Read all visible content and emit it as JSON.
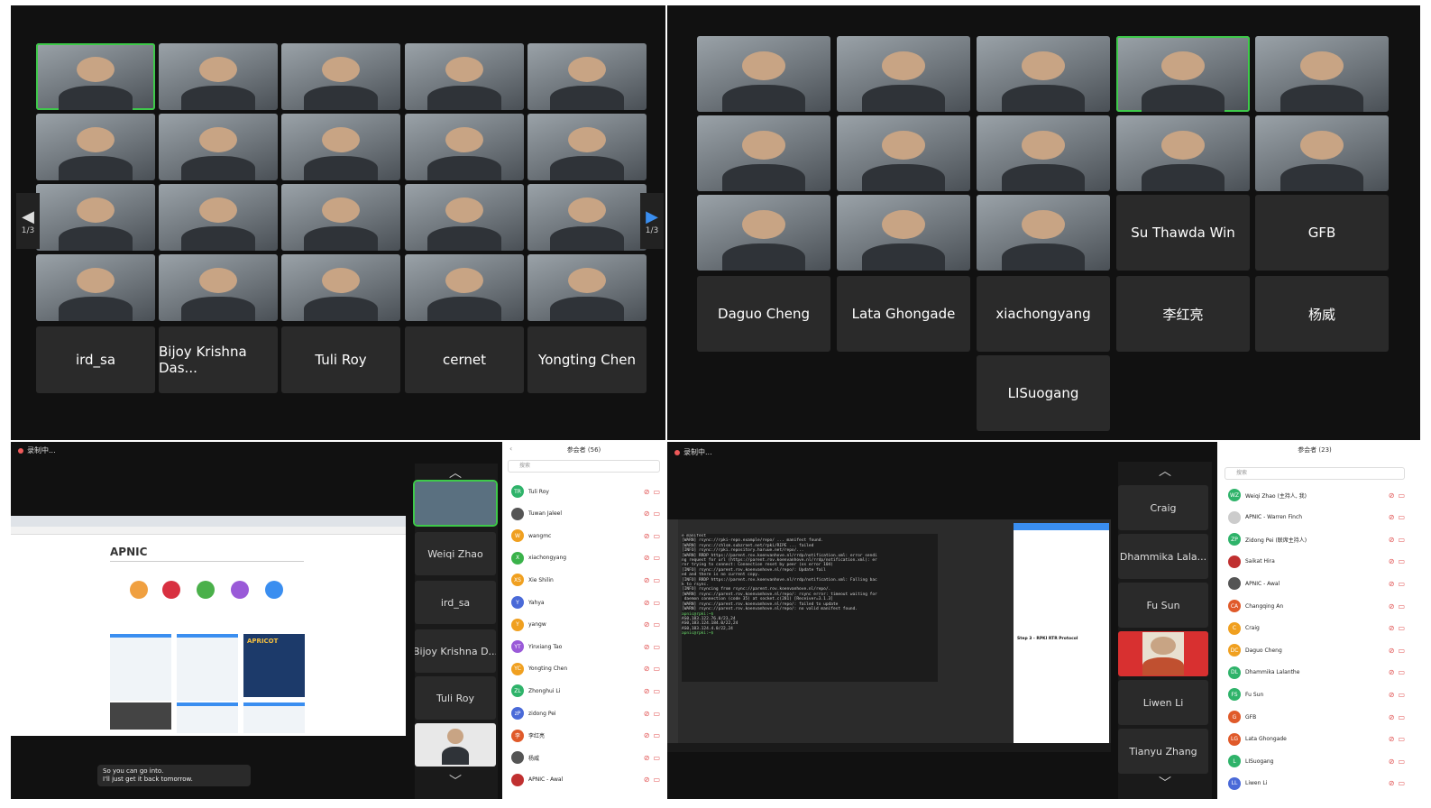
{
  "colors": {
    "active_border": "#3ec94a",
    "rec_dot": "#f05a5a",
    "nav_blue": "#3a8ef0",
    "tile_bg": "#2a2a2a"
  },
  "q1": {
    "tiles_row1": [
      "",
      "",
      "",
      "",
      ""
    ],
    "name_tiles": [
      "ird_sa",
      "Bijoy Krishna Das...",
      "Tuli Roy",
      "cernet",
      "Yongting Chen"
    ],
    "page_left": "1/3",
    "page_right": "1/3",
    "left_arrow_icon": "chevron-left-icon",
    "right_arrow_icon": "chevron-right-icon"
  },
  "q2": {
    "name_tiles_row3": [
      "Su Thawda Win",
      "GFB"
    ],
    "name_tiles_row4": [
      "Daguo Cheng",
      "Lata Ghongade",
      "xiachongyang",
      "李红亮",
      "杨威"
    ],
    "name_tile_row5": "LISuogang"
  },
  "q3": {
    "rec_label": "录制中...",
    "page_brand": "APNIC",
    "strip_names": [
      "Weiqi Zhao",
      "ird_sa",
      "Bijoy Krishna D...",
      "Tuli Roy"
    ],
    "caption": "So you can go into.\nI'll just get it back tomorrow.",
    "apricot_label": "APRICOT"
  },
  "plist1": {
    "title": "参会者 (56)",
    "search": "搜索",
    "rows": [
      {
        "initials": "TR",
        "name": "Tuli Roy",
        "color": "#2fb36a"
      },
      {
        "initials": "",
        "name": "Tuwan Jaleel",
        "color": "#555555"
      },
      {
        "initials": "W",
        "name": "wangmc",
        "color": "#f0a020"
      },
      {
        "initials": "X",
        "name": "xiachongyang",
        "color": "#3ab24a"
      },
      {
        "initials": "XS",
        "name": "Xie Shilin",
        "color": "#f0a020"
      },
      {
        "initials": "Y",
        "name": "Yahya",
        "color": "#4a6ad8"
      },
      {
        "initials": "Y",
        "name": "yangw",
        "color": "#f0a020"
      },
      {
        "initials": "YT",
        "name": "Yinxiang Tao",
        "color": "#9a5ad8"
      },
      {
        "initials": "YC",
        "name": "Yongting Chen",
        "color": "#f0a020"
      },
      {
        "initials": "ZL",
        "name": "Zhonghui Li",
        "color": "#2fb36a"
      },
      {
        "initials": "zP",
        "name": "zidong Pei",
        "color": "#4a6ad8"
      },
      {
        "initials": "李",
        "name": "李红亮",
        "color": "#e05a2a"
      },
      {
        "initials": "",
        "name": "杨威",
        "color": "#555555"
      },
      {
        "initials": "",
        "name": "APNIC - Awal",
        "color": "#c03030"
      }
    ]
  },
  "q4": {
    "rec_label": "录制中...",
    "strip_names": [
      "Craig",
      "Dhammika Lala...",
      "Fu Sun",
      "",
      "Liwen Li",
      "Tianyu Zhang"
    ],
    "panel_heading": "Step 3 - RPKI RTR Protocol",
    "terminal_lines": [
      "e manifest",
      "[WARN] rsync://rpki-repo.example/repo/ ... manifest found.",
      "[WARN] rsync://chlsm.subzrnet.net/rpki/RIPE ... failed",
      "[INFO] rsync://rpki.repository.haruue.net/repo/...",
      "[WARN] RRDP https://parent.rov.koenvanhove.nl/rrdp/notification.xml: error sendi",
      "ng request for url (https://parent.rov.koenvanhove.nl/rrdp/notification.xml): er",
      "ror trying to connect: Connection reset by peer (os error 104)",
      "[INFO] rsync://parent.rov.koenvanhove.nl/repo/: Update fail",
      "ed and there is no current copy.",
      "[INFO] RRDP https://parent.rov.koenvanhove.nl/rrdp/notification.xml: Falling bac",
      "k to rsync.",
      "[INFO] rsyncing from rsync://parent.rov.koenvanhove.nl/repo/.",
      "[WARN] rsync://parent.rov.koenvanhove.nl/repo/: rsync error: timeout waiting for",
      " daemon connection (code 35) at socket.c(281) [Receiver=3.1.3]",
      "[WARN] rsync://parent.rov.koenvanhove.nl/repo/: failed to update",
      "[WARN] rsync://parent.rov.koenvanhove.nl/repo/: no valid manifest found.",
      "apnic@rpki:~$",
      "AS0,183.122.76.0/23,24",
      "AS0,183.124.184.0/22,24",
      "AS0,183.124.4.0/22,24",
      "apnic@rpki:~$"
    ]
  },
  "plist2": {
    "title": "参会者 (23)",
    "search": "搜索",
    "rows": [
      {
        "initials": "WZ",
        "name": "Weiqi Zhao (主持人, 我)",
        "color": "#2fb36a"
      },
      {
        "initials": "",
        "name": "APNIC - Warren Finch",
        "color": "#cccccc"
      },
      {
        "initials": "ZP",
        "name": "Zidong Pei (联席主持人)",
        "color": "#2fb36a"
      },
      {
        "initials": "",
        "name": "Saikat Hira",
        "color": "#c03030"
      },
      {
        "initials": "",
        "name": "APNIC - Awal",
        "color": "#555555"
      },
      {
        "initials": "CA",
        "name": "Changqing An",
        "color": "#e05a2a"
      },
      {
        "initials": "C",
        "name": "Craig",
        "color": "#f0a020"
      },
      {
        "initials": "DC",
        "name": "Daguo Cheng",
        "color": "#f0a020"
      },
      {
        "initials": "DL",
        "name": "Dhammika Lalanthe",
        "color": "#2fb36a"
      },
      {
        "initials": "FS",
        "name": "Fu Sun",
        "color": "#2fb36a"
      },
      {
        "initials": "G",
        "name": "GFB",
        "color": "#e05a2a"
      },
      {
        "initials": "LG",
        "name": "Lata Ghongade",
        "color": "#e05a2a"
      },
      {
        "initials": "L",
        "name": "LISuogang",
        "color": "#2fb36a"
      },
      {
        "initials": "LL",
        "name": "Liwen Li",
        "color": "#4a6ad8"
      }
    ]
  }
}
